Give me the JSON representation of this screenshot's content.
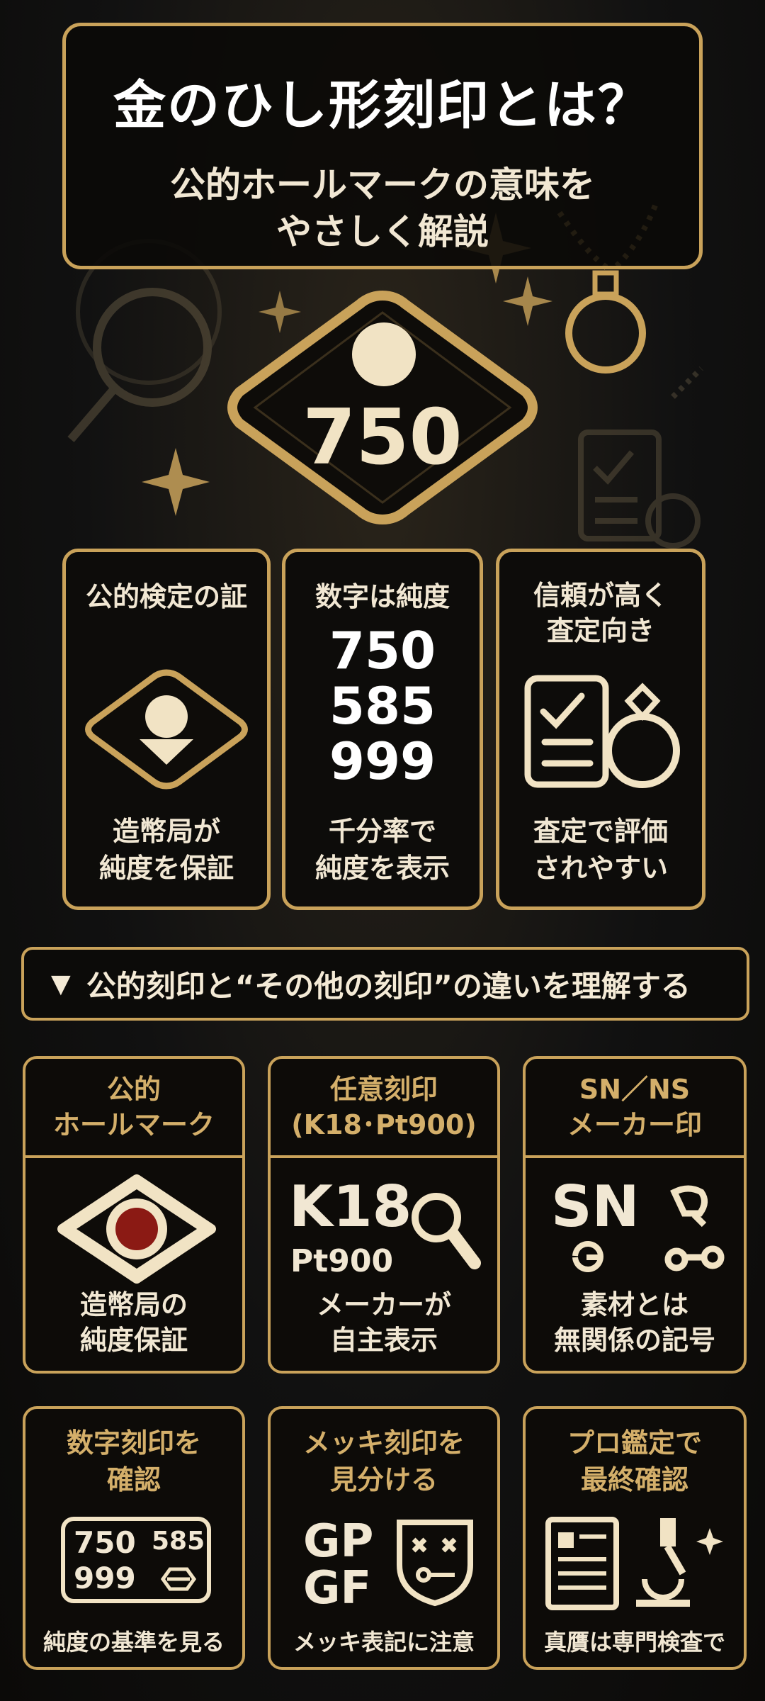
{
  "header": {
    "title": "金のひし形刻印とは？",
    "subtitle_line1": "公的ホールマークの意味を",
    "subtitle_line2": "やさしく解説"
  },
  "hero_mark": {
    "number": "750"
  },
  "features": [
    {
      "title": "公的検定の証",
      "caption_line1": "造幣局が",
      "caption_line2": "純度を保証"
    },
    {
      "title": "数字は純度",
      "numbers": [
        "750",
        "585",
        "999"
      ],
      "caption_line1": "千分率で",
      "caption_line2": "純度を表示"
    },
    {
      "title_line1": "信頼が高く",
      "title_line2": "査定向き",
      "caption_line1": "査定で評価",
      "caption_line2": "されやすい"
    }
  ],
  "section": {
    "arrow": "▼",
    "title": "公的刻印と“その他の刻印”の違いを理解する"
  },
  "compare": [
    {
      "head_line1": "公的",
      "head_line2": "ホールマーク",
      "foot_line1": "造幣局の",
      "foot_line2": "純度保証"
    },
    {
      "head_line1": "任意刻印",
      "head_line2": "(K18･Pt900)",
      "mark_big": "K18",
      "mark_small": "Pt900",
      "foot_line1": "メーカーが",
      "foot_line2": "自主表示"
    },
    {
      "head_line1": "SN／NS",
      "head_line2": "メーカー印",
      "mark_big": "SN",
      "foot_line1": "素材とは",
      "foot_line2": "無関係の記号"
    }
  ],
  "tips": [
    {
      "head_line1": "数字刻印を",
      "head_line2": "確認",
      "n1": "750",
      "n2": "585",
      "n3": "999",
      "foot": "純度の基準を見る"
    },
    {
      "head_line1": "メッキ刻印を",
      "head_line2": "見分ける",
      "m1": "GP",
      "m2": "GF",
      "foot": "メッキ表記に注意"
    },
    {
      "head_line1": "プロ鑑定で",
      "head_line2": "最終確認",
      "foot": "真贋は専門検査で"
    }
  ],
  "colors": {
    "gold": "#c9a25a",
    "cream": "#f1e7d3",
    "red_dot": "#8b1a14"
  }
}
